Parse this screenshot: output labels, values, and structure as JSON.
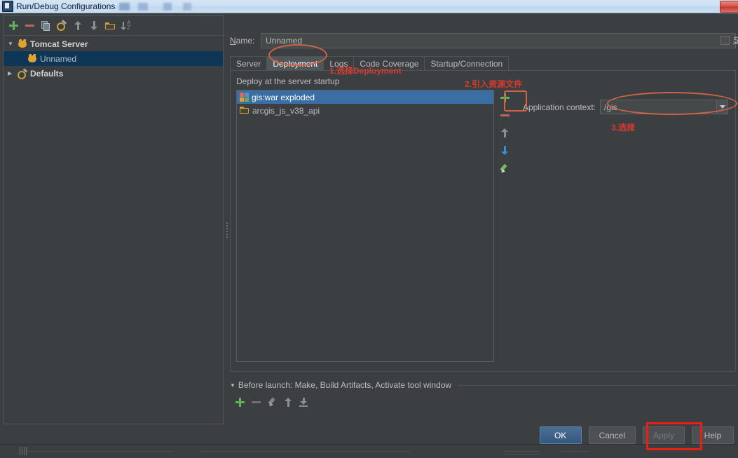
{
  "window": {
    "title": "Run/Debug Configurations",
    "app_icon": "intellij-icon",
    "close_label": ""
  },
  "sidebar": {
    "toolbar": [
      {
        "name": "add-configuration-button",
        "icon": "plus-icon"
      },
      {
        "name": "remove-configuration-button",
        "icon": "minus-icon"
      },
      {
        "name": "copy-configuration-button",
        "icon": "copy-icon"
      },
      {
        "name": "edit-defaults-button",
        "icon": "wrench-icon"
      },
      {
        "name": "move-up-button",
        "icon": "arrow-up-icon"
      },
      {
        "name": "move-down-button",
        "icon": "arrow-down-icon"
      },
      {
        "name": "create-folder-button",
        "icon": "folder-icon"
      },
      {
        "name": "sort-configurations-button",
        "icon": "sort-icon"
      }
    ],
    "tree": [
      {
        "label": "Tomcat Server",
        "icon": "tomcat-icon",
        "expanded": true,
        "bold": true,
        "selected": false,
        "indent": 0
      },
      {
        "label": "Unnamed",
        "icon": "tomcat-icon",
        "expanded": null,
        "bold": false,
        "selected": true,
        "indent": 1
      },
      {
        "label": "Defaults",
        "icon": "defaults-icon",
        "expanded": false,
        "bold": true,
        "selected": false,
        "indent": 0
      }
    ]
  },
  "main": {
    "name_label": "Name:",
    "name_value": "Unnamed",
    "name_placeholder": "Unnamed",
    "share_label": "Share",
    "share_checked": false,
    "tabs": [
      {
        "label": "Server",
        "active": false
      },
      {
        "label": "Deployment",
        "active": true
      },
      {
        "label": "Logs",
        "active": false
      },
      {
        "label": "Code Coverage",
        "active": false
      },
      {
        "label": "Startup/Connection",
        "active": false
      }
    ],
    "deploy_label": "Deploy at the server startup",
    "deploy_items": [
      {
        "label": "gis:war exploded",
        "icon": "artifact-icon",
        "selected": true
      },
      {
        "label": "arcgis_js_v38_api",
        "icon": "folder-icon",
        "selected": false
      }
    ],
    "list_toolbar": [
      {
        "name": "add-artifact-button",
        "icon": "plus-icon"
      },
      {
        "name": "remove-artifact-button",
        "icon": "minus-icon"
      },
      {
        "name": "move-artifact-up-button",
        "icon": "arrow-up-icon"
      },
      {
        "name": "move-artifact-down-button",
        "icon": "arrow-down-icon"
      },
      {
        "name": "edit-artifact-button",
        "icon": "pencil-icon"
      }
    ],
    "application_context_label": "Application context:",
    "application_context_value": "/gis",
    "before_launch_text": "Before launch: Make, Build Artifacts, Activate tool window",
    "before_launch_toolbar": [
      {
        "name": "add-before-launch-task-button",
        "icon": "plus-icon"
      },
      {
        "name": "remove-before-launch-task-button",
        "icon": "minus-icon"
      },
      {
        "name": "edit-before-launch-task-button",
        "icon": "pencil-icon"
      },
      {
        "name": "before-launch-move-up-button",
        "icon": "arrow-up-icon"
      },
      {
        "name": "before-launch-move-down-button",
        "icon": "arrow-down-icon"
      }
    ]
  },
  "footer": {
    "ok_label": "OK",
    "cancel_label": "Cancel",
    "apply_label": "Apply",
    "help_label": "Help"
  },
  "annotations": [
    {
      "id": "step1",
      "text": "1.选择Deployment"
    },
    {
      "id": "step2",
      "text": "2.引入资源文件"
    },
    {
      "id": "step3",
      "text": "3.选择"
    }
  ],
  "colors": {
    "accent_blue": "#3a6ea5",
    "annotation_red": "#e03a2f",
    "annotation_box": "#d2634a",
    "apply_box": "#ea1f13",
    "window_bg": "#3c3f41",
    "titlebar_blue": "#cfe1f4"
  }
}
